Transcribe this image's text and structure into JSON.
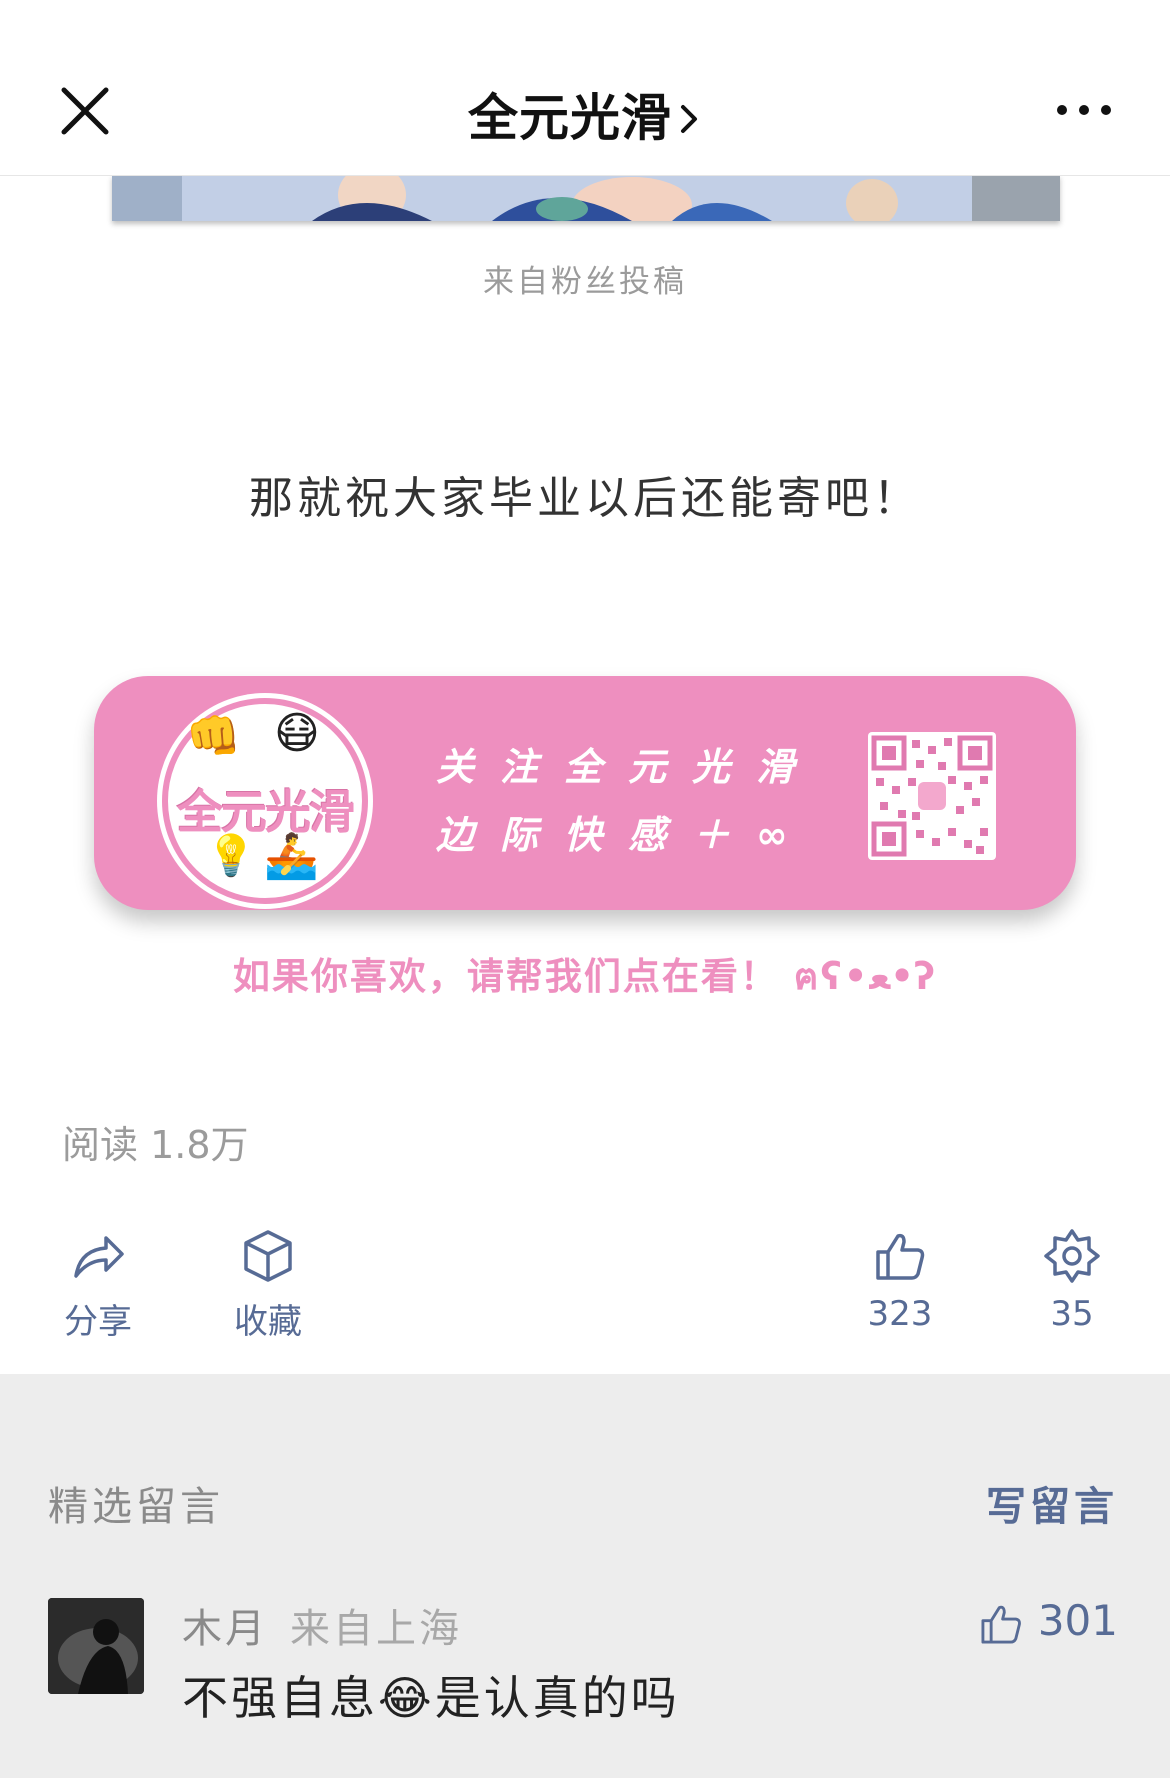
{
  "nav": {
    "title": "全元光滑"
  },
  "article": {
    "image_caption": "来自粉丝投稿",
    "body_text": "那就祝大家毕业以后还能寄吧！",
    "banner": {
      "logo_text": "全元光滑",
      "line1": "关注全元光滑",
      "line2": "边际快感＋∞",
      "subtext": "如果你喜欢，请帮我们点在看！ ฅʕ•ﻌ•ʔ",
      "accent_color": "#ee8fbf"
    },
    "read_count": "阅读 1.8万"
  },
  "actions": {
    "share": "分享",
    "favorite": "收藏",
    "like_count": "323",
    "wow_count": "35"
  },
  "comments": {
    "header": "精选留言",
    "write": "写留言",
    "items": [
      {
        "name": "木月",
        "location": "来自上海",
        "text": "不强自息😂是认真的吗",
        "likes": "301"
      }
    ]
  },
  "colors": {
    "link": "#576b95",
    "muted": "#9b9b9b",
    "comments_bg": "#ededed"
  }
}
